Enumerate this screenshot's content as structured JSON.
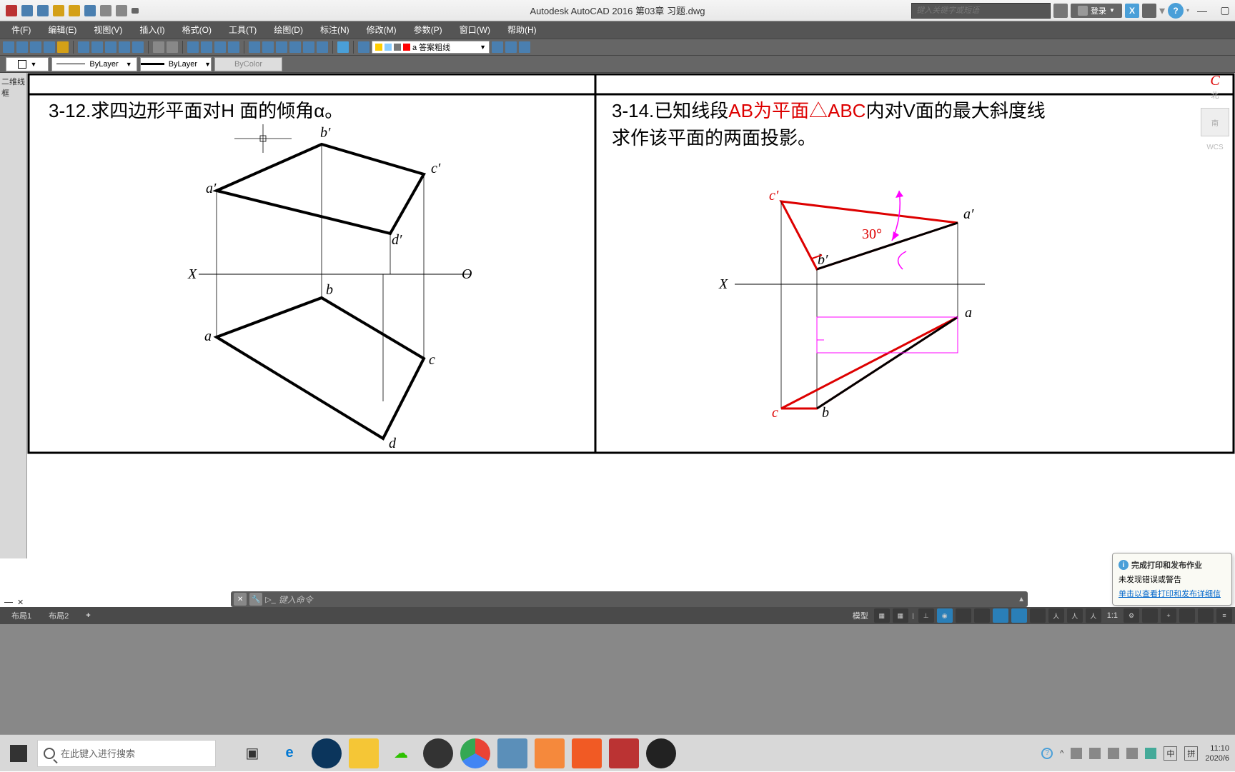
{
  "app": {
    "title_full": "Autodesk AutoCAD 2016    第03章 习题.dwg",
    "search_placeholder": "键入关键字或短语",
    "login": "登录",
    "help": "?"
  },
  "menus": [
    "件(F)",
    "编辑(E)",
    "视图(V)",
    "插入(I)",
    "格式(O)",
    "工具(T)",
    "绘图(D)",
    "标注(N)",
    "修改(M)",
    "参数(P)",
    "窗口(W)",
    "帮助(H)"
  ],
  "layer": {
    "current": "a 答案粗线"
  },
  "props": {
    "color": "ByLayer",
    "linetype": "ByLayer",
    "lineweight": "ByLayer",
    "plotstyle": "ByColor"
  },
  "dock_tab": "二维线框",
  "compass": {
    "north": "C",
    "north_ch": "北",
    "face": "南",
    "wcs": "WCS"
  },
  "problem_312": {
    "num": "3-12.",
    "text": "求四边形平面对H 面的倾角α。",
    "labels": {
      "a": "a",
      "b": "b",
      "c": "c",
      "d": "d",
      "ap": "a′",
      "bp": "b′",
      "cp": "c′",
      "dp": "d′",
      "X": "X",
      "O": "O"
    }
  },
  "problem_314": {
    "num": "3-14.",
    "text1": "已知线段",
    "ab": "AB",
    "text2": "为平面",
    "tri": "△ABC",
    "text3": "内对V面的最大斜度线",
    "text4": "求作该平面的两面投影。",
    "angle": "30°",
    "labels": {
      "a": "a",
      "b": "b",
      "c": "c",
      "ap": "a′",
      "bp": "b′",
      "cp": "c′",
      "X": "X"
    }
  },
  "notify": {
    "title": "完成打印和发布作业",
    "msg": "未发现错误或警告",
    "link": "单击以查看打印和发布详细信"
  },
  "cmd": {
    "placeholder": "键入命令"
  },
  "layout_tabs": [
    "布局1",
    "布局2",
    "+"
  ],
  "status": {
    "model": "模型",
    "scale": "1:1"
  },
  "taskbar": {
    "search": "在此键入进行搜索",
    "time": "11:10",
    "date": "2020/6",
    "ime": "中",
    "kbd": "拼"
  }
}
